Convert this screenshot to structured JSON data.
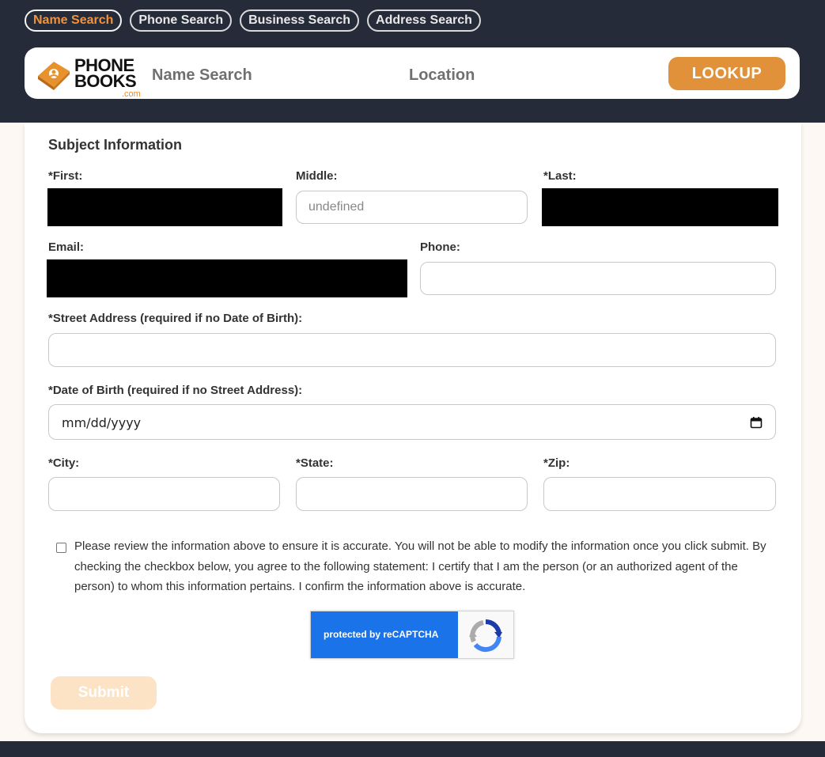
{
  "nav": {
    "tabs": [
      {
        "label": "Name Search",
        "active": true
      },
      {
        "label": "Phone Search",
        "active": false
      },
      {
        "label": "Business Search",
        "active": false
      },
      {
        "label": "Address Search",
        "active": false
      }
    ]
  },
  "header": {
    "logo_line1": "PHONE",
    "logo_line2": "BOOKS",
    "logo_suffix": ".com",
    "name_placeholder": "Name Search",
    "location_placeholder": "Location",
    "lookup_label": "LOOKUP"
  },
  "form": {
    "section_title": "Subject Information",
    "first_label": "*First:",
    "middle_label": "Middle:",
    "middle_value": "undefined",
    "last_label": "*Last:",
    "email_label": "Email:",
    "phone_label": "Phone:",
    "phone_value": "",
    "street_label": "*Street Address (required if no Date of Birth):",
    "street_value": "",
    "dob_label": "*Date of Birth (required if no Street Address):",
    "dob_placeholder": "mm/dd/yyyy",
    "city_label": "*City:",
    "state_label": "*State:",
    "zip_label": "*Zip:",
    "consent_checked": false,
    "consent_text": "Please review the information above to ensure it is accurate. You will not be able to modify the information once you click submit. By checking the checkbox below, you agree to the following statement: I certify that I am the person (or an authorized agent of the person) to whom this information pertains. I confirm the information above is accurate.",
    "recaptcha_text": "protected by reCAPTCHA",
    "submit_label": "Submit"
  },
  "colors": {
    "dark_bg": "#252b38",
    "accent": "#e0913a",
    "active_tab": "#f2923a",
    "submit_disabled": "#fde3c6",
    "recaptcha_blue": "#1a73e8"
  }
}
